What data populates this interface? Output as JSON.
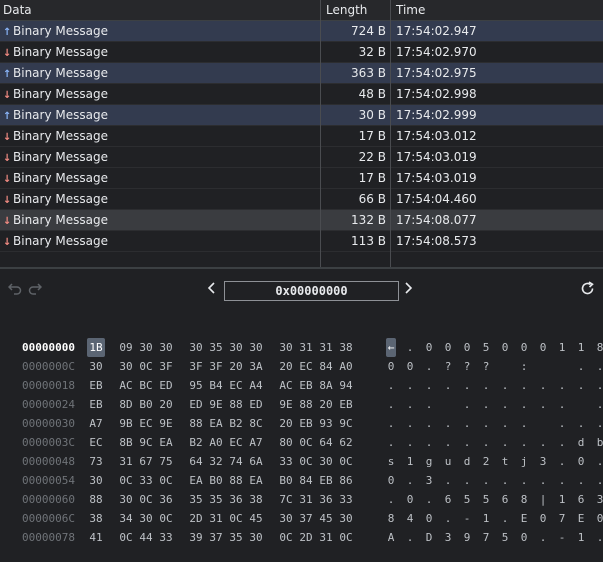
{
  "table": {
    "columns": [
      "Data",
      "Length",
      "Time"
    ],
    "rows": [
      {
        "direction": "up",
        "label": "Binary Message",
        "length": "724 B",
        "time": "17:54:02.947"
      },
      {
        "direction": "down",
        "label": "Binary Message",
        "length": "32 B",
        "time": "17:54:02.970"
      },
      {
        "direction": "up",
        "label": "Binary Message",
        "length": "363 B",
        "time": "17:54:02.975"
      },
      {
        "direction": "down",
        "label": "Binary Message",
        "length": "48 B",
        "time": "17:54:02.998"
      },
      {
        "direction": "up",
        "label": "Binary Message",
        "length": "30 B",
        "time": "17:54:02.999"
      },
      {
        "direction": "down",
        "label": "Binary Message",
        "length": "17 B",
        "time": "17:54:03.012"
      },
      {
        "direction": "down",
        "label": "Binary Message",
        "length": "22 B",
        "time": "17:54:03.019"
      },
      {
        "direction": "down",
        "label": "Binary Message",
        "length": "17 B",
        "time": "17:54:03.019"
      },
      {
        "direction": "down",
        "label": "Binary Message",
        "length": "66 B",
        "time": "17:54:04.460"
      },
      {
        "direction": "down",
        "label": "Binary Message",
        "length": "132 B",
        "time": "17:54:08.077",
        "selected": true
      },
      {
        "direction": "down",
        "label": "Binary Message",
        "length": "113 B",
        "time": "17:54:08.573"
      }
    ]
  },
  "toolbar": {
    "offset_value": "0x00000000",
    "prev_icon": "chevron-left-icon",
    "next_icon": "chevron-right-icon",
    "undo_icon": "undo-icon",
    "redo_icon": "redo-icon",
    "refresh_icon": "refresh-icon"
  },
  "hex": {
    "rows": [
      {
        "offset": "00000000",
        "bytes": [
          "1B",
          "09",
          "30",
          "30",
          "30",
          "35",
          "30",
          "30",
          "30",
          "31",
          "31",
          "38"
        ],
        "chars": [
          "←",
          ".",
          "0",
          "0",
          "0",
          "5",
          "0",
          "0",
          "0",
          "1",
          "1",
          "8"
        ]
      },
      {
        "offset": "0000000C",
        "bytes": [
          "30",
          "30",
          "0C",
          "3F",
          "3F",
          "3F",
          "20",
          "3A",
          "20",
          "EC",
          "84",
          "A0"
        ],
        "chars": [
          "0",
          "0",
          ".",
          "?",
          "?",
          "?",
          "",
          ":",
          "",
          "",
          ".",
          "."
        ]
      },
      {
        "offset": "00000018",
        "bytes": [
          "EB",
          "AC",
          "BC",
          "ED",
          "95",
          "B4",
          "EC",
          "A4",
          "AC",
          "EB",
          "8A",
          "94"
        ],
        "chars": [
          ".",
          ".",
          ".",
          ".",
          ".",
          ".",
          ".",
          ".",
          ".",
          ".",
          ".",
          "."
        ]
      },
      {
        "offset": "00000024",
        "bytes": [
          "EB",
          "8D",
          "B0",
          "20",
          "ED",
          "9E",
          "88",
          "ED",
          "9E",
          "88",
          "20",
          "EB"
        ],
        "chars": [
          ".",
          ".",
          ".",
          "",
          ".",
          ".",
          ".",
          ".",
          ".",
          ".",
          "",
          "."
        ]
      },
      {
        "offset": "00000030",
        "bytes": [
          "A7",
          "9B",
          "EC",
          "9E",
          "88",
          "EA",
          "B2",
          "8C",
          "20",
          "EB",
          "93",
          "9C"
        ],
        "chars": [
          ".",
          ".",
          ".",
          ".",
          ".",
          ".",
          ".",
          ".",
          "",
          ".",
          ".",
          "."
        ]
      },
      {
        "offset": "0000003C",
        "bytes": [
          "EC",
          "8B",
          "9C",
          "EA",
          "B2",
          "A0",
          "EC",
          "A7",
          "80",
          "0C",
          "64",
          "62"
        ],
        "chars": [
          ".",
          ".",
          ".",
          ".",
          ".",
          ".",
          ".",
          ".",
          ".",
          ".",
          "d",
          "b"
        ]
      },
      {
        "offset": "00000048",
        "bytes": [
          "73",
          "31",
          "67",
          "75",
          "64",
          "32",
          "74",
          "6A",
          "33",
          "0C",
          "30",
          "0C"
        ],
        "chars": [
          "s",
          "1",
          "g",
          "u",
          "d",
          "2",
          "t",
          "j",
          "3",
          ".",
          "0",
          "."
        ]
      },
      {
        "offset": "00000054",
        "bytes": [
          "30",
          "0C",
          "33",
          "0C",
          "EA",
          "B0",
          "88",
          "EA",
          "B0",
          "84",
          "EB",
          "86"
        ],
        "chars": [
          "0",
          ".",
          "3",
          ".",
          ".",
          ".",
          ".",
          ".",
          ".",
          ".",
          ".",
          "."
        ]
      },
      {
        "offset": "00000060",
        "bytes": [
          "88",
          "30",
          "0C",
          "36",
          "35",
          "35",
          "36",
          "38",
          "7C",
          "31",
          "36",
          "33"
        ],
        "chars": [
          ".",
          "0",
          ".",
          "6",
          "5",
          "5",
          "6",
          "8",
          "|",
          "1",
          "6",
          "3"
        ]
      },
      {
        "offset": "0000006C",
        "bytes": [
          "38",
          "34",
          "30",
          "0C",
          "2D",
          "31",
          "0C",
          "45",
          "30",
          "37",
          "45",
          "30"
        ],
        "chars": [
          "8",
          "4",
          "0",
          ".",
          "-",
          "1",
          ".",
          "E",
          "0",
          "7",
          "E",
          "0"
        ]
      },
      {
        "offset": "00000078",
        "bytes": [
          "41",
          "0C",
          "44",
          "33",
          "39",
          "37",
          "35",
          "30",
          "0C",
          "2D",
          "31",
          "0C"
        ],
        "chars": [
          "A",
          ".",
          "D",
          "3",
          "9",
          "7",
          "5",
          "0",
          ".",
          "-",
          "1",
          "."
        ]
      }
    ]
  }
}
